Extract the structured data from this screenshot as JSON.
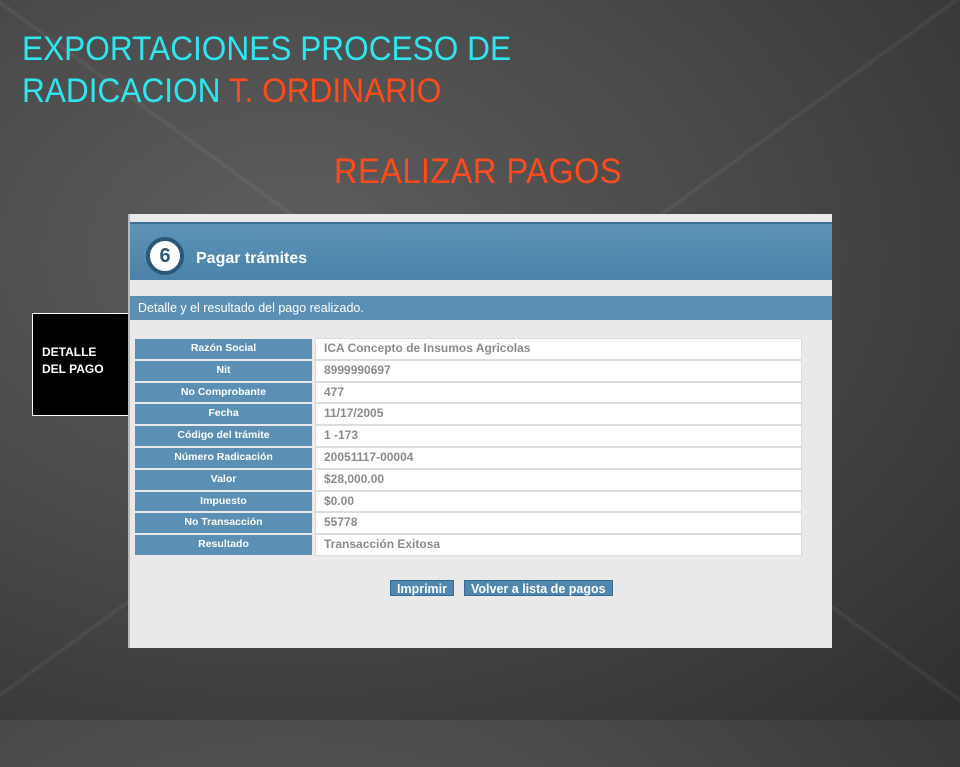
{
  "slide": {
    "title_line1": "EXPORTACIONES PROCESO DE",
    "title_line2_main": "RADICACION ",
    "title_line2_accent": "T. ORDINARIO",
    "subtitle": "REALIZAR  PAGOS",
    "side_label_line1": "DETALLE",
    "side_label_line2": "DEL PAGO"
  },
  "screen": {
    "step_number": "6",
    "header_title": "Pagar trámites",
    "description": "Detalle y el resultado del pago realizado.",
    "rows": [
      {
        "label": "Razón Social",
        "value": "ICA Concepto de Insumos Agricolas"
      },
      {
        "label": "Nit",
        "value": "8999990697"
      },
      {
        "label": "No Comprobante",
        "value": "477"
      },
      {
        "label": "Fecha",
        "value": "11/17/2005"
      },
      {
        "label": "Código del trámite",
        "value": "1 -173"
      },
      {
        "label": "Número Radicación",
        "value": "20051117-00004"
      },
      {
        "label": "Valor",
        "value": "$28,000.00"
      },
      {
        "label": "Impuesto",
        "value": "$0.00"
      },
      {
        "label": "No Transacción",
        "value": "55778"
      },
      {
        "label": "Resultado",
        "value": "Transacción Exitosa"
      }
    ],
    "print_button": "Imprimir",
    "back_button": "Volver a lista de pagos"
  },
  "colors": {
    "title_cyan": "#2ee6f0",
    "accent_orange": "#ff4a1c",
    "header_blue": "#4a82a9"
  }
}
